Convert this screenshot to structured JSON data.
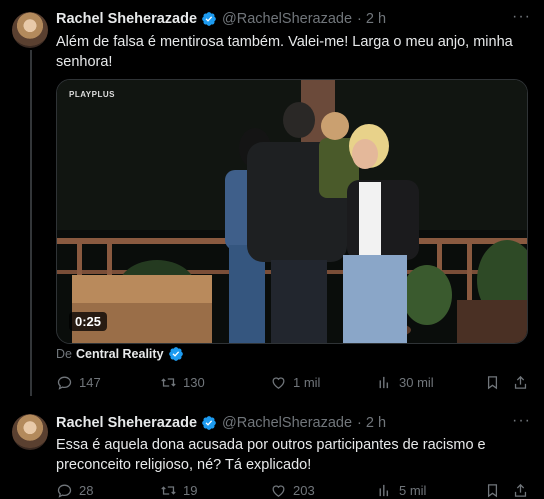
{
  "tweets": [
    {
      "author_name": "Rachel Sheherazade",
      "handle": "@RachelSherazade",
      "time": "· 2 h",
      "text": "Além de falsa é mentirosa também. Valei-me! Larga o meu anjo, minha senhora!",
      "media": {
        "watermark": "PLAYPLUS",
        "duration": "0:25"
      },
      "from_prefix": "De",
      "from_source": "Central Reality",
      "stats": {
        "replies": "147",
        "retweets": "130",
        "likes": "1 mil",
        "views": "30 mil"
      }
    },
    {
      "author_name": "Rachel Sheherazade",
      "handle": "@RachelSherazade",
      "time": "· 2 h",
      "text": "Essa é aquela dona acusada por outros participantes de racismo e preconceito religioso, né? Tá explicado!",
      "stats": {
        "replies": "28",
        "retweets": "19",
        "likes": "203",
        "views": "5 mil"
      }
    }
  ],
  "colors": {
    "background": "#000000",
    "text": "#e7e9ea",
    "muted": "#71767b",
    "verified": "#1d9bf0"
  },
  "icons": [
    "more-icon",
    "verified-badge-icon",
    "reply-icon",
    "retweet-icon",
    "like-icon",
    "views-icon",
    "bookmark-icon",
    "share-icon"
  ]
}
